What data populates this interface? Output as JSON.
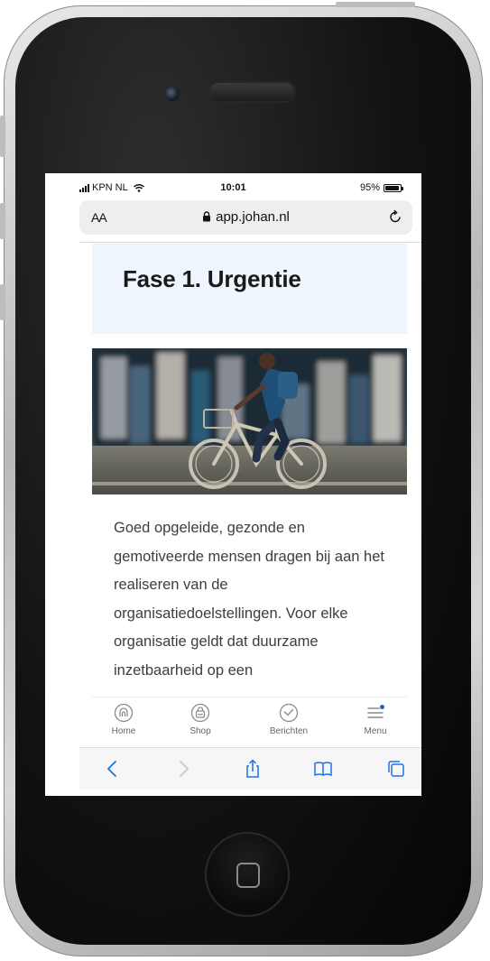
{
  "status_bar": {
    "carrier": "KPN NL",
    "time": "10:01",
    "battery": "95%",
    "battery_level": 0.95
  },
  "browser": {
    "text_size_label": "AA",
    "url": "app.johan.nl",
    "icons": [
      "lock-icon",
      "reload-icon",
      "back-arrow-icon",
      "forward-arrow-icon",
      "share-icon",
      "bookmarks-icon",
      "tabs-icon"
    ]
  },
  "page": {
    "title": "Fase 1. Urgentie",
    "body": "Goed opgeleide, gezonde en gemotiveerde mensen dragen bij aan het realiseren van de organisatiedoelstellingen. Voor elke organisatie geldt dat duurzame inzetbaarheid op een"
  },
  "tabs": [
    {
      "label": "Home",
      "icon": "home-icon"
    },
    {
      "label": "Shop",
      "icon": "shop-bag-icon"
    },
    {
      "label": "Berichten",
      "icon": "message-check-icon"
    },
    {
      "label": "Menu",
      "icon": "menu-icon"
    }
  ],
  "colors": {
    "hero_background": "#eef5fc",
    "menu_badge": "#1e5aa8",
    "browser_accent": "#1a73e8"
  }
}
